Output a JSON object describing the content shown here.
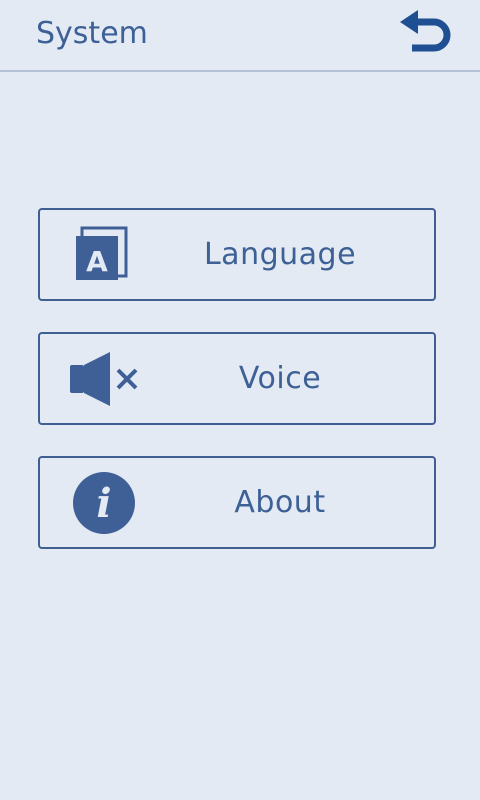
{
  "header": {
    "title": "System",
    "back_icon": "back-arrow-icon"
  },
  "menu": {
    "items": [
      {
        "label": "Language",
        "icon": "language-icon"
      },
      {
        "label": "Voice",
        "icon": "speaker-muted-icon"
      },
      {
        "label": "About",
        "icon": "info-icon"
      }
    ]
  },
  "colors": {
    "background": "#e3eaf4",
    "accent": "#3d6096",
    "icon_blue": "#3f5f97",
    "back_icon": "#1f4f93",
    "divider": "#b3c2d9"
  }
}
